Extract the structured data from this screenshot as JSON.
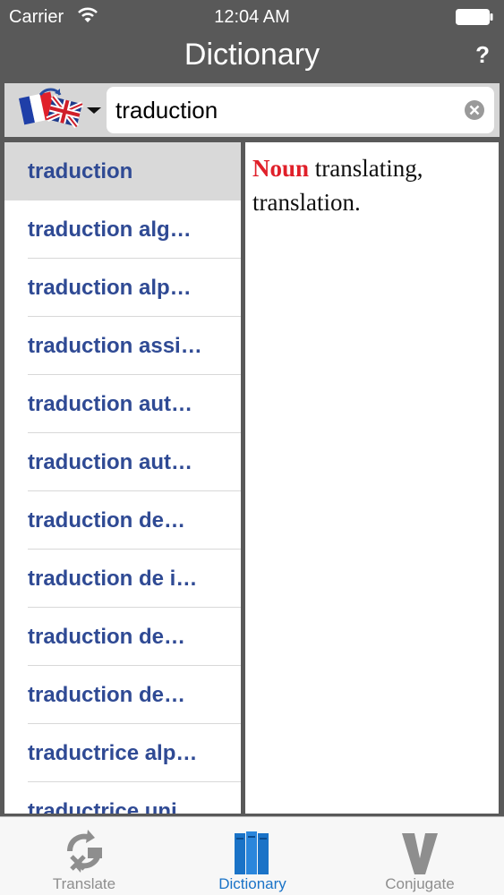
{
  "status_bar": {
    "carrier": "Carrier",
    "time": "12:04 AM"
  },
  "nav": {
    "title": "Dictionary",
    "help_label": "?"
  },
  "search": {
    "value": "traduction"
  },
  "results": [
    "traduction",
    "traduction alg…",
    "traduction alp…",
    "traduction assi…",
    "traduction aut…",
    "traduction aut…",
    "traduction de…",
    "traduction de i…",
    "traduction de…",
    "traduction de…",
    "traductrice alp…",
    "traductrice uni…"
  ],
  "selected_result_index": 0,
  "definition": {
    "part_of_speech": "Noun",
    "text": " translating, translation."
  },
  "tabs": [
    {
      "label": "Translate",
      "icon": "translate-icon"
    },
    {
      "label": "Dictionary",
      "icon": "dictionary-books-icon"
    },
    {
      "label": "Conjugate",
      "icon": "conjugate-v-icon"
    }
  ],
  "active_tab": "Dictionary",
  "colors": {
    "accent": "#1a73c7",
    "link": "#2f4a94",
    "part_of_speech": "#e0202a",
    "chrome": "#595959"
  }
}
